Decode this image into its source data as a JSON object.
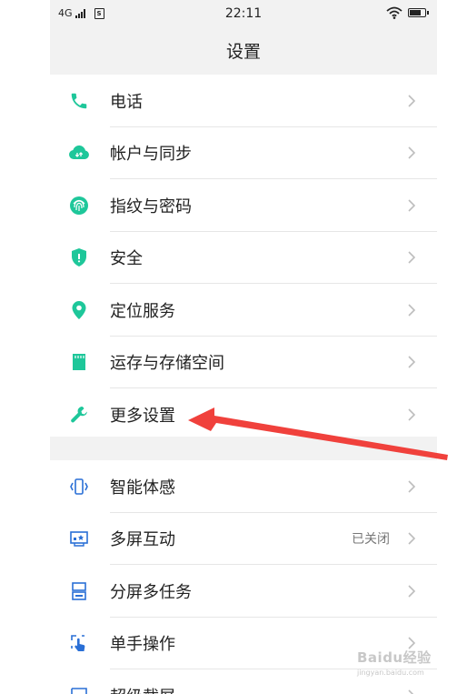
{
  "status_bar": {
    "network": "4G",
    "sim_label": "S",
    "time": "22:11"
  },
  "title": "设置",
  "section1": [
    {
      "label": "电话",
      "icon": "phone-icon"
    },
    {
      "label": "帐户与同步",
      "icon": "cloud-sync-icon"
    },
    {
      "label": "指纹与密码",
      "icon": "fingerprint-icon"
    },
    {
      "label": "安全",
      "icon": "shield-icon"
    },
    {
      "label": "定位服务",
      "icon": "location-pin-icon"
    },
    {
      "label": "运存与存储空间",
      "icon": "sd-card-icon"
    },
    {
      "label": "更多设置",
      "icon": "wrench-icon"
    }
  ],
  "section2": [
    {
      "label": "智能体感",
      "icon": "motion-icon"
    },
    {
      "label": "多屏互动",
      "value": "已关闭",
      "icon": "screen-cast-icon"
    },
    {
      "label": "分屏多任务",
      "icon": "split-screen-icon"
    },
    {
      "label": "单手操作",
      "icon": "one-hand-icon"
    },
    {
      "label": "超级截屏",
      "icon": "screenshot-icon"
    }
  ],
  "watermark": {
    "main": "Baidu经验",
    "sub": "jingyan.baidu.com"
  },
  "colors": {
    "accent": "#1ec79a",
    "secondary_icon": "#2a6fd6",
    "annotation_arrow": "#f0413c"
  }
}
